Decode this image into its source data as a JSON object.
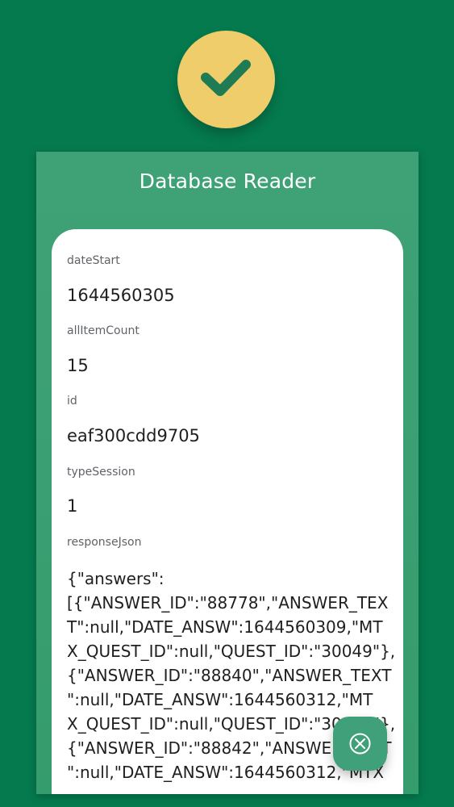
{
  "icons": {
    "success": "checkmark-icon",
    "close": "close-circle-icon"
  },
  "colors": {
    "background": "#057a4e",
    "panel": "#3fa277",
    "badge": "#efcd6b",
    "check": "#1f7b53",
    "fab": "#3fa07a"
  },
  "panel": {
    "title": "Database Reader"
  },
  "fields": [
    {
      "label": "dateStart",
      "value": "1644560305"
    },
    {
      "label": "allItemCount",
      "value": "15"
    },
    {
      "label": "id",
      "value": "eaf300cdd9705"
    },
    {
      "label": "typeSession",
      "value": "1"
    },
    {
      "label": "responseJson",
      "value": "{\"answers\":\n[{\"ANSWER_ID\":\"88778\",\"ANSWER_TEX\nT\":null,\"DATE_ANSW\":1644560309,\"MT\nX_QUEST_ID\":null,\"QUEST_ID\":\"30049\"},\n{\"ANSWER_ID\":\"88840\",\"ANSWER_TEXT\n\":null,\"DATE_ANSW\":1644560312,\"MT\nX_QUEST_ID\":null,\"QUEST_ID\":\"30050\"},\n{\"ANSWER_ID\":\"88842\",\"ANSWER_TEXT\n\":null,\"DATE_ANSW\":1644560312,\"MTX"
    }
  ]
}
